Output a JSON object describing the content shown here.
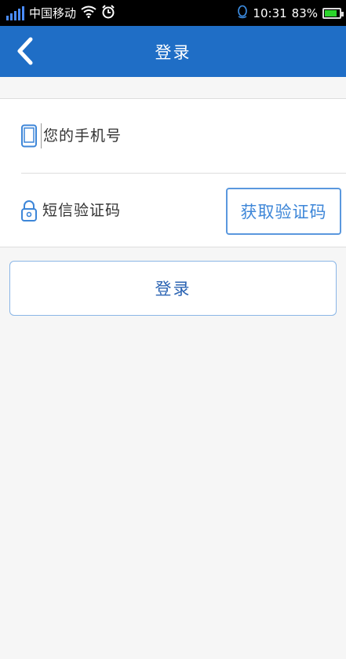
{
  "status_bar": {
    "carrier": "中国移动",
    "time": "10:31",
    "battery": "83%",
    "battery_level": 0.83,
    "icons": [
      "signal-icon",
      "wifi-icon",
      "alarm-icon",
      "qq-icon",
      "battery-icon"
    ]
  },
  "header": {
    "title": "登录",
    "back_icon": "chevron-left-icon"
  },
  "form": {
    "phone": {
      "placeholder": "您的手机号",
      "value": "",
      "icon": "phone-icon"
    },
    "code": {
      "placeholder": "短信验证码",
      "value": "",
      "icon": "lock-icon"
    },
    "get_code_label": "获取验证码"
  },
  "login_label": "登录",
  "colors": {
    "header_bg": "#1f6ec6",
    "accent": "#3d86d8",
    "page_bg": "#f6f6f6"
  }
}
